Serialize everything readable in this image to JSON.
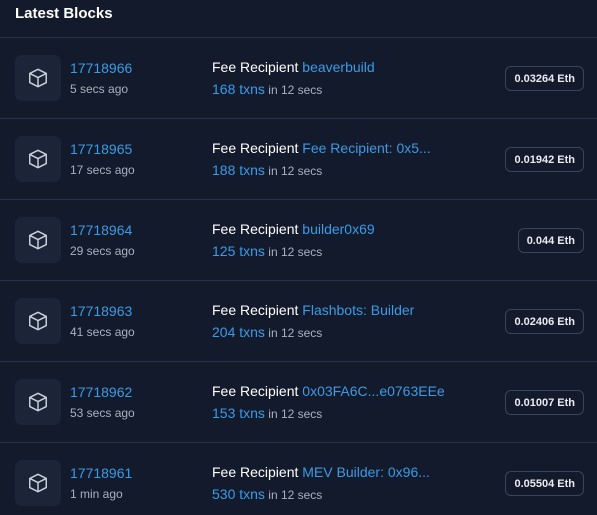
{
  "title": "Latest Blocks",
  "fee_label": "Fee Recipient",
  "txn_suffix": "in 12 secs",
  "blocks": [
    {
      "number": "17718966",
      "age": "5 secs ago",
      "recipient": "beaverbuild",
      "txns": "168 txns",
      "reward": "0.03264 Eth"
    },
    {
      "number": "17718965",
      "age": "17 secs ago",
      "recipient": "Fee Recipient: 0x5...",
      "txns": "188 txns",
      "reward": "0.01942 Eth"
    },
    {
      "number": "17718964",
      "age": "29 secs ago",
      "recipient": "builder0x69",
      "txns": "125 txns",
      "reward": "0.044 Eth"
    },
    {
      "number": "17718963",
      "age": "41 secs ago",
      "recipient": "Flashbots: Builder",
      "txns": "204 txns",
      "reward": "0.02406 Eth"
    },
    {
      "number": "17718962",
      "age": "53 secs ago",
      "recipient": "0x03FA6C...e0763EEe",
      "txns": "153 txns",
      "reward": "0.01007 Eth"
    },
    {
      "number": "17718961",
      "age": "1 min ago",
      "recipient": "MEV Builder: 0x96...",
      "txns": "530 txns",
      "reward": "0.05504 Eth"
    }
  ],
  "icons": {
    "block": "cube-icon"
  }
}
